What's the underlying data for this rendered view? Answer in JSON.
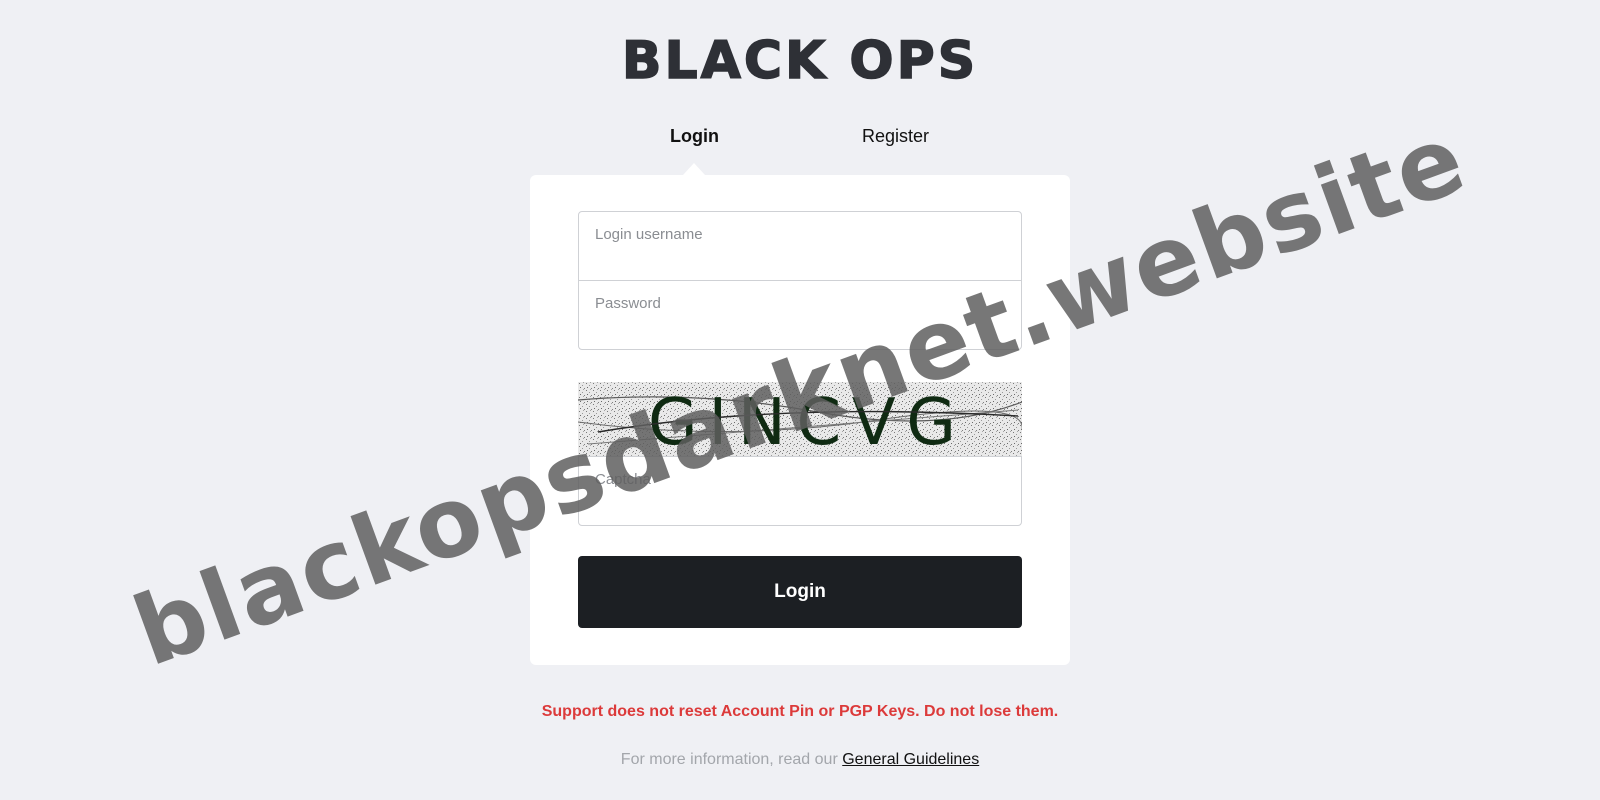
{
  "brand": {
    "logo_text": "BLACK OPS"
  },
  "tabs": [
    {
      "label": "Login",
      "active": true
    },
    {
      "label": "Register",
      "active": false
    }
  ],
  "form": {
    "username_placeholder": "Login username",
    "username_value": "",
    "password_placeholder": "Password",
    "password_value": "",
    "captcha_text": "GINCVG",
    "captcha_placeholder": "Captcha",
    "captcha_value": "",
    "submit_label": "Login"
  },
  "notices": {
    "warning": "Support does not reset Account Pin or PGP Keys. Do not lose them.",
    "info_prefix": "For more information, read our",
    "info_link": "General Guidelines"
  },
  "watermark": "blackopsdarknet.website",
  "colors": {
    "background": "#eff0f4",
    "card": "#ffffff",
    "button": "#1c1f23",
    "warning": "#dc3a3a",
    "captcha_text": "#0f2a12"
  }
}
